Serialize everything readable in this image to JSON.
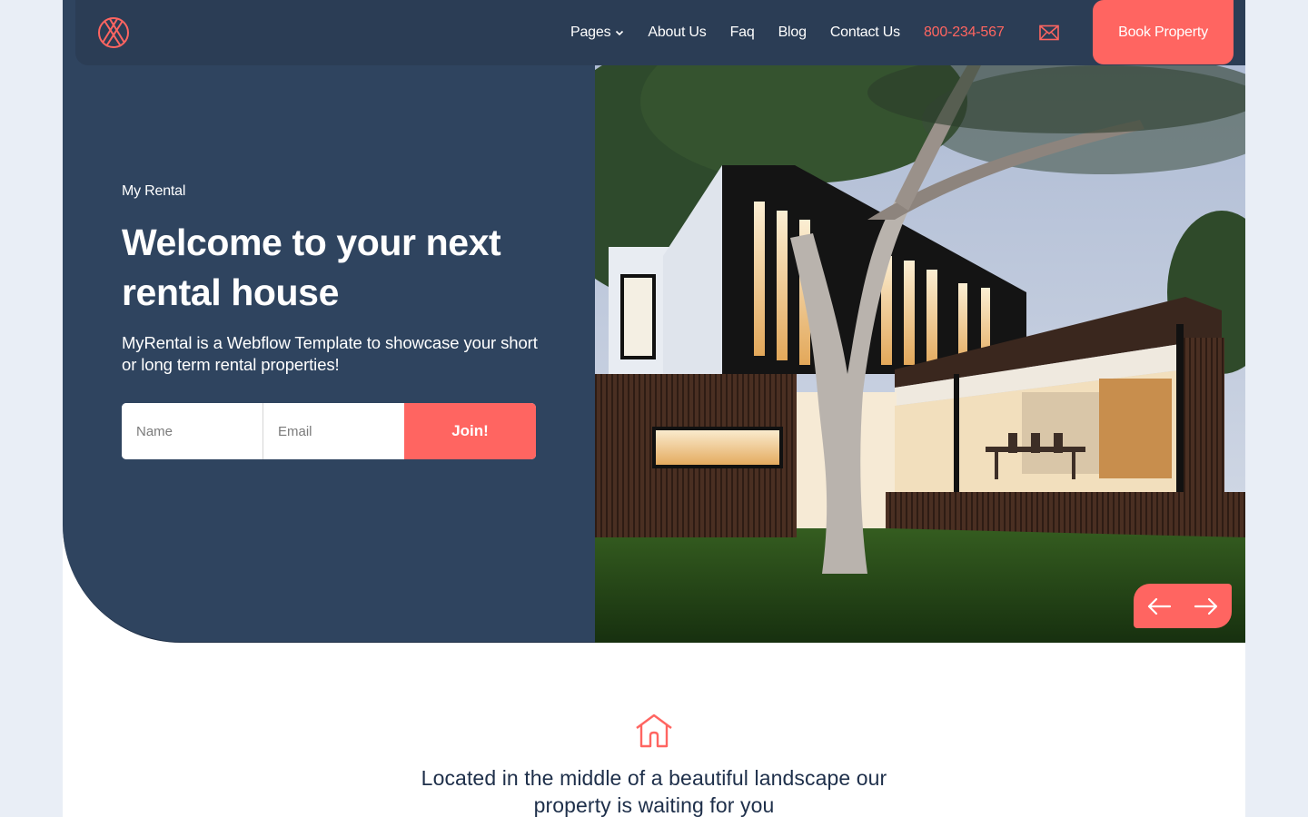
{
  "header": {
    "logo": "crosshatch-circle-logo",
    "nav": [
      {
        "label": "Pages",
        "has_dropdown": true
      },
      {
        "label": "About Us"
      },
      {
        "label": "Faq"
      },
      {
        "label": "Blog"
      },
      {
        "label": "Contact Us"
      }
    ],
    "phone": "800-234-567",
    "mail_icon": "envelope-icon",
    "cta_label": "Book Property"
  },
  "hero": {
    "eyebrow": "My Rental",
    "title": "Welcome to your next rental house",
    "subtitle": "MyRental is a Webflow Template to showcase your short or long term rental properties!",
    "form": {
      "name_placeholder": "Name",
      "email_placeholder": "Email",
      "name_value": "",
      "email_value": "",
      "submit_label": "Join!"
    },
    "image_alt": "Modern two-storey house with wood cladding and large tree at dusk",
    "slider": {
      "prev_icon": "arrow-left-icon",
      "next_icon": "arrow-right-icon"
    }
  },
  "feature": {
    "icon": "house-icon",
    "text": "Located in the middle of a beautiful landscape our property is waiting for you"
  },
  "colors": {
    "accent": "#ff6561",
    "navy": "#2f445f",
    "header": "#2b3d55",
    "page_bg": "#e9eef6",
    "heading_text": "#1e2f4a"
  }
}
